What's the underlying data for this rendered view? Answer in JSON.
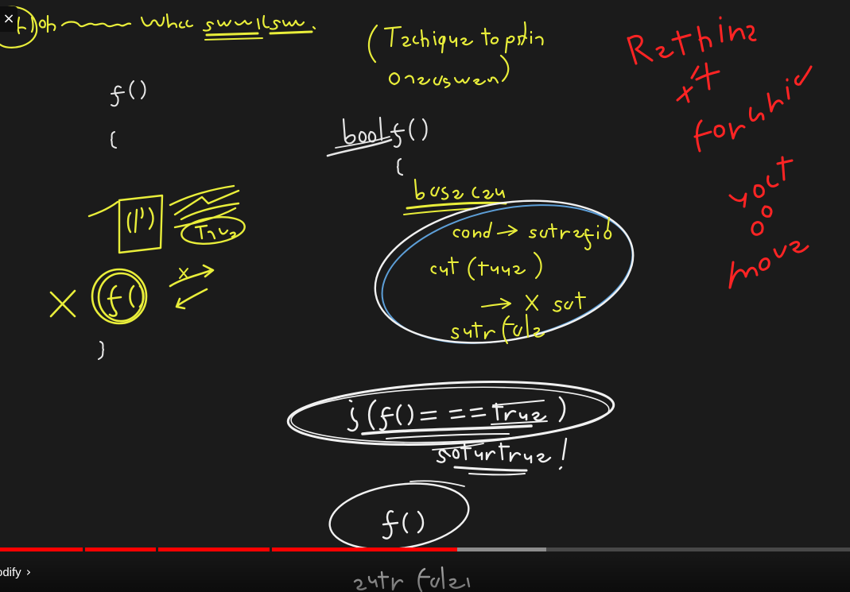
{
  "player": {
    "close_glyph": "×",
    "chapter": {
      "title": "odify",
      "chevron": "›"
    },
    "progress": {
      "played_fraction": 0.538,
      "loaded_fraction": 0.643,
      "chapter_marks": [
        0.097,
        0.183,
        0.317
      ]
    },
    "colors": {
      "background": "#1b1b1b",
      "played": "#ff0000",
      "pen_yellow": "#e9ee3a",
      "pen_white": "#f1f1f1",
      "pen_red": "#ff2424",
      "pen_blue": "#5d9fd8"
    }
  }
}
